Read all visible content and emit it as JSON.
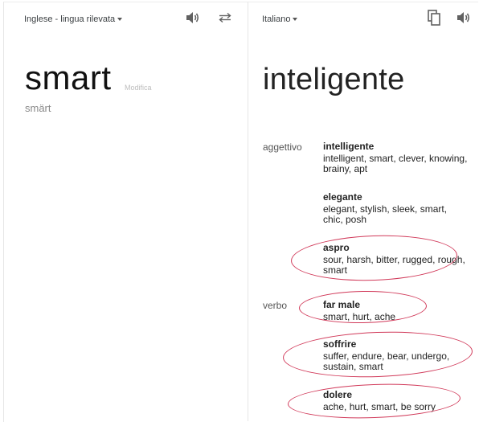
{
  "source": {
    "language_label": "Inglese - lingua rilevata",
    "word": "smart",
    "edit_label": "Modifica",
    "transliteration": "smärt"
  },
  "target": {
    "language_label": "Italiano",
    "word": "inteligente"
  },
  "dictionary": [
    {
      "pos": "aggettivo",
      "entries": [
        {
          "word": "intelligente",
          "synonyms": "intelligent, smart, clever, knowing, brainy, apt",
          "circled": false
        },
        {
          "word": "elegante",
          "synonyms": "elegant, stylish, sleek, smart, chic, posh",
          "circled": false
        },
        {
          "word": "aspro",
          "synonyms": "sour, harsh, bitter, rugged, rough, smart",
          "circled": true
        }
      ]
    },
    {
      "pos": "verbo",
      "entries": [
        {
          "word": "far male",
          "synonyms": "smart, hurt, ache",
          "circled": true
        },
        {
          "word": "soffrire",
          "synonyms": "suffer, endure, bear, undergo, sustain, smart",
          "circled": true
        },
        {
          "word": "dolere",
          "synonyms": "ache, hurt, smart, be sorry",
          "circled": true
        }
      ]
    }
  ],
  "icons": {
    "source_listen": "speaker-icon",
    "swap": "swap-arrows-icon",
    "copy": "copy-icon",
    "target_listen": "speaker-icon"
  },
  "colors": {
    "annotation_ring": "#d13a5a",
    "divider": "#e6e6e6",
    "muted_text": "#8a8a8a"
  }
}
